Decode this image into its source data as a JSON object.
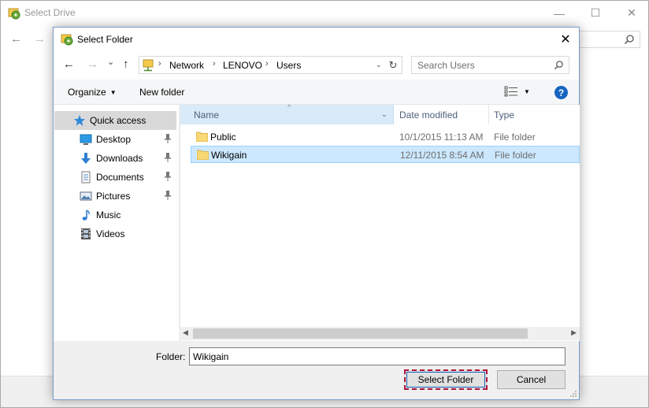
{
  "background_window": {
    "title": "Select Drive",
    "controls": {
      "minimize": "—",
      "maximize": "☐",
      "close": "✕"
    },
    "nav": {
      "back": "←",
      "forward": "→"
    },
    "search_icon": "search-icon"
  },
  "dialog": {
    "title": "Select Folder",
    "close_glyph": "✕",
    "nav": {
      "back": "←",
      "forward": "→",
      "recent": "⌄",
      "up": "↑"
    },
    "address": {
      "crumbs": [
        "Network",
        "LENOVO",
        "Users"
      ],
      "separator": "›",
      "dropdown": "⌄",
      "refresh": "↻"
    },
    "search": {
      "placeholder": "Search Users"
    },
    "toolbar": {
      "organize": "Organize",
      "new_folder": "New folder",
      "help": "?"
    },
    "nav_pane": {
      "items": [
        {
          "label": "Quick access",
          "icon": "star-icon",
          "active": true
        },
        {
          "label": "Desktop",
          "icon": "desktop-icon",
          "pinned": true
        },
        {
          "label": "Downloads",
          "icon": "downloads-icon",
          "pinned": true
        },
        {
          "label": "Documents",
          "icon": "documents-icon",
          "pinned": true
        },
        {
          "label": "Pictures",
          "icon": "pictures-icon",
          "pinned": true
        },
        {
          "label": "Music",
          "icon": "music-icon"
        },
        {
          "label": "Videos",
          "icon": "videos-icon"
        }
      ]
    },
    "file_list": {
      "columns": [
        "Name",
        "Date modified",
        "Type"
      ],
      "rows": [
        {
          "name": "Public",
          "date": "10/1/2015 11:13 AM",
          "type": "File folder",
          "selected": false
        },
        {
          "name": "Wikigain",
          "date": "12/11/2015 8:54 AM",
          "type": "File folder",
          "selected": true
        }
      ]
    },
    "footer": {
      "folder_label": "Folder:",
      "folder_value": "Wikigain",
      "select_button": "Select Folder",
      "cancel_button": "Cancel"
    }
  },
  "colors": {
    "accent": "#1565c0",
    "selection": "#cce8ff",
    "focus_border": "#b0123c"
  }
}
